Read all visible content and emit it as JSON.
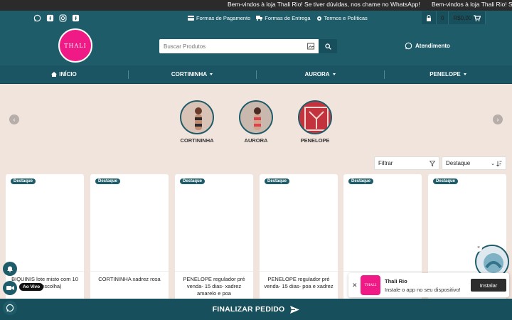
{
  "announcement": {
    "messages": [
      "Bem-vindos à loja Thali Rio! Se tiver dúvidas, nos chame no WhatsApp!",
      "Bem-vindos à loja Thali Rio! Se tiver dúvidas, nos chame no WhatsApp!"
    ]
  },
  "social": [
    "whatsapp-icon",
    "facebook-icon",
    "instagram-icon",
    "facebook-icon"
  ],
  "toplinks": {
    "pagamento": "Formas de Pagamento",
    "entrega": "Formas de Entrega",
    "termos": "Termos e Políticas"
  },
  "cart": {
    "count": "0",
    "total": "R$0,00"
  },
  "header": {
    "logo_text": "THALI",
    "search_placeholder": "Buscar Produtos",
    "atendimento": "Atendimento"
  },
  "nav": {
    "items": [
      {
        "label": "INÍCIO"
      },
      {
        "label": "CORTININHA"
      },
      {
        "label": "AURORA"
      },
      {
        "label": "PENELOPE"
      }
    ]
  },
  "categories": [
    {
      "label": "CORTININHA"
    },
    {
      "label": "AURORA"
    },
    {
      "label": "PENELOPE"
    }
  ],
  "filters": {
    "filtrar": "Filtrar",
    "ordem": "Destaque"
  },
  "products": [
    {
      "badge": "Destaque",
      "name": "BIQUINIS lote misto com 10 (sem escolha)"
    },
    {
      "badge": "Destaque",
      "name": "CORTININHA xadrez rosa"
    },
    {
      "badge": "Destaque",
      "name": "PENELOPE regulador pré venda- 15 dias- xadrez amarelo e poa"
    },
    {
      "badge": "Destaque",
      "name": "PENELOPE regulador pré venda- 15 dias- poa e xadrez"
    },
    {
      "badge": "Destaque",
      "name": ""
    },
    {
      "badge": "Destaque",
      "name": ""
    }
  ],
  "live": {
    "label": "Ao Vivo"
  },
  "bottom": {
    "finalizar": "FINALIZAR PEDIDO"
  },
  "install": {
    "app_name": "Thali Rio",
    "message": "Instale o app no seu dispositivo!",
    "button": "Instalar"
  },
  "colors": {
    "primary": "#1f5c6a",
    "brand": "#ef1a85",
    "background": "#f1e4dc"
  }
}
